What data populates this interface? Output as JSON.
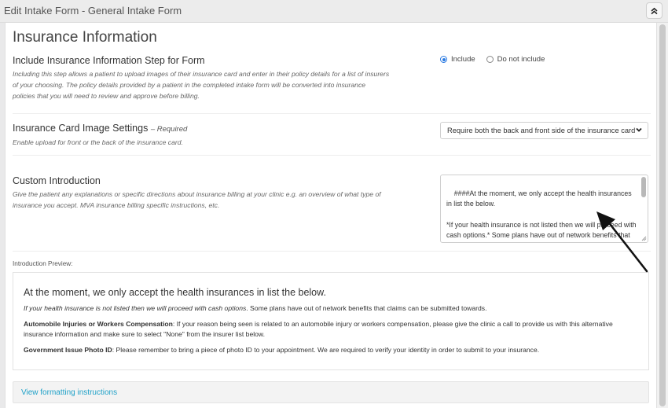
{
  "window": {
    "title": "Edit Intake Form - General Intake Form"
  },
  "section": {
    "heading": "Insurance Information"
  },
  "include_step": {
    "title": "Include Insurance Information Step for Form",
    "description": "Including this step allows a patient to upload images of their insurance card and enter in their policy details for a list of insurers of your choosing. The policy details provided by a patient in the completed intake form will be converted into insurance policies that you will need to review and approve before billing.",
    "options": [
      {
        "label": "Include",
        "checked": true
      },
      {
        "label": "Do not include",
        "checked": false
      }
    ]
  },
  "card_settings": {
    "title": "Insurance Card Image Settings",
    "required_label": "– Required",
    "description": "Enable upload for front or the back of the insurance card.",
    "selected_value": "Require both the back and front side of the insurance card"
  },
  "custom_intro": {
    "title": "Custom Introduction",
    "description": "Give the patient any explanations or specific directions about insurance billing at your clinic e.g. an overview of what type of insurance you accept. MVA insurance billing specific instructions, etc.",
    "textarea_value": "####At the moment, we only accept the health insurances in list the below.\n\n*If your health insurance is not listed then we will proceed with cash options.* Some plans have out of network benefits that claims can be submitted towards."
  },
  "preview": {
    "label": "Introduction Preview:",
    "heading": "At the moment, we only accept the health insurances in list the below.",
    "p1_italic": "If your health insurance is not listed then we will proceed with cash options",
    "p1_rest": ". Some plans have out of network benefits that claims can be submitted towards.",
    "p2_bold": "Automobile Injuries or Workers Compensation",
    "p2_rest": ": If your reason being seen is related to an automobile injury or workers compensation, please give the clinic a call to provide us with this alternative insurance information and make sure to select \"None\" from the insurer list below.",
    "p3_bold": "Government Issue Photo ID",
    "p3_rest": ": Please remember to bring a piece of photo ID to your appointment. We are required to verify your identity in order to submit to your insurance."
  },
  "formatting": {
    "link_label": "View formatting instructions"
  },
  "colors": {
    "accent": "#2a7ae2",
    "link": "#1fa1c8"
  },
  "icons": {
    "collapse": "double-chevron-up-icon",
    "dropdown": "chevron-down-icon",
    "annotation": "arrow-icon"
  }
}
